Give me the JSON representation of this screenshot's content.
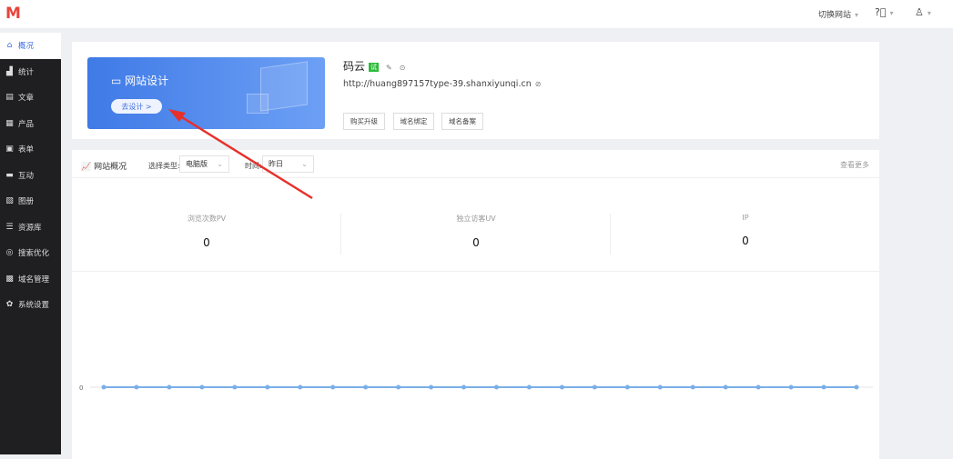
{
  "header": {
    "logo": "M",
    "switch_site": "切换网站",
    "help_icon": "help-icon",
    "user_icon": "user-icon"
  },
  "sidebar": {
    "items": [
      {
        "label": "概况",
        "icon": "home-icon",
        "active": true
      },
      {
        "label": "统计",
        "icon": "chart-icon"
      },
      {
        "label": "文章",
        "icon": "article-icon"
      },
      {
        "label": "产品",
        "icon": "grid-icon"
      },
      {
        "label": "表单",
        "icon": "form-icon"
      },
      {
        "label": "互动",
        "icon": "chat-icon"
      },
      {
        "label": "图册",
        "icon": "album-icon"
      },
      {
        "label": "资源库",
        "icon": "database-icon"
      },
      {
        "label": "搜索优化",
        "icon": "seo-icon"
      },
      {
        "label": "域名管理",
        "icon": "domain-icon"
      },
      {
        "label": "系统设置",
        "icon": "gear-icon"
      }
    ]
  },
  "banner": {
    "title": "网站设计",
    "button": "去设计 >"
  },
  "site": {
    "name": "码云",
    "badge": "试",
    "url": "http://huang897157type-39.shanxiyunqi.cn",
    "buttons": [
      "购买升级",
      "域名绑定",
      "域名备案"
    ]
  },
  "overview": {
    "title": "网站概况",
    "type_label": "选择类型:",
    "type_value": "电脑版",
    "time_label": "时间:",
    "time_value": "昨日",
    "more": "查看更多",
    "stats": [
      {
        "label": "浏览次数PV",
        "value": "0"
      },
      {
        "label": "独立访客UV",
        "value": "0"
      },
      {
        "label": "IP",
        "value": "0"
      }
    ]
  },
  "colors": {
    "accent": "#3d6ee0",
    "sidebar": "#1f1f21",
    "line": "#7aaee8"
  },
  "chart_data": {
    "type": "line",
    "y_ticks": [
      "0"
    ],
    "series": [
      {
        "values": [
          0,
          0,
          0,
          0,
          0,
          0,
          0,
          0,
          0,
          0,
          0,
          0,
          0,
          0,
          0,
          0,
          0,
          0,
          0,
          0,
          0,
          0,
          0,
          0
        ]
      }
    ],
    "grid": true
  }
}
